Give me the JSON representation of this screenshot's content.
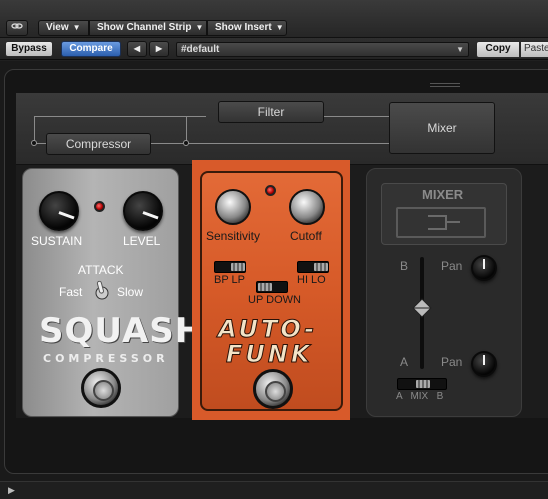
{
  "toolbar": {
    "link_icon": "link-icon",
    "view_label": "View",
    "channel_strip_label": "Show Channel Strip",
    "insert_label": "Show Insert",
    "bypass_label": "Bypass",
    "compare_label": "Compare",
    "prev_arrow": "◀",
    "next_arrow": "▶",
    "preset_value": "#default",
    "copy_label": "Copy",
    "paste_label": "Paste"
  },
  "routing": {
    "compressor_label": "Compressor",
    "filter_label": "Filter",
    "mixer_label": "Mixer"
  },
  "squash": {
    "sustain_label": "SUSTAIN",
    "level_label": "LEVEL",
    "attack_label": "ATTACK",
    "fast_label": "Fast",
    "slow_label": "Slow",
    "title": "SQUASH",
    "subtitle": "COMPRESSOR"
  },
  "autofunk": {
    "sensitivity_label": "Sensitivity",
    "cutoff_label": "Cutoff",
    "bp_lp_label": "BP  LP",
    "hi_lo_label": "HI  LO",
    "up_down_label": "UP  DOWN",
    "title_line1": "AUTO-",
    "title_line2": "FUNK"
  },
  "mixer": {
    "header_label": "MIXER",
    "b_label": "B",
    "a_label": "A",
    "pan_top_label": "Pan",
    "pan_bottom_label": "Pan",
    "mix_label": "A   MIX   B"
  },
  "bottom": {
    "play_icon": "▶"
  }
}
